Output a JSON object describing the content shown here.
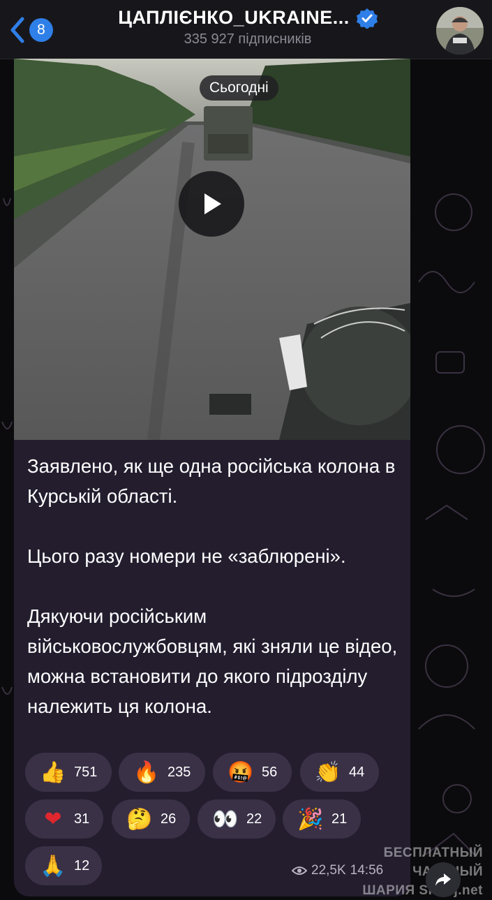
{
  "header": {
    "unread_count": "8",
    "channel_title": "ЦАПЛІЄНКО_UKRAINE...",
    "subscribers": "335 927 підписників"
  },
  "video": {
    "date_label": "Сьогодні"
  },
  "message": {
    "paragraphs": [
      "Заявлено, як ще одна російська колона в Курській області.",
      "Цього разу номери не «заблюрені».",
      "Дякуючи російським військовослужбовцям, які зняли це відео, можна встановити до якого підрозділу належить ця колона."
    ]
  },
  "reactions": [
    {
      "emoji": "👍",
      "count": "751"
    },
    {
      "emoji": "🔥",
      "count": "235"
    },
    {
      "emoji": "🤬",
      "count": "56"
    },
    {
      "emoji": "👏",
      "count": "44"
    },
    {
      "emoji": "❤",
      "count": "31"
    },
    {
      "emoji": "🤔",
      "count": "26"
    },
    {
      "emoji": "👀",
      "count": "22"
    },
    {
      "emoji": "🎉",
      "count": "21"
    },
    {
      "emoji": "🙏",
      "count": "12"
    }
  ],
  "meta": {
    "views": "22,5K",
    "time": "14:56"
  },
  "watermark": {
    "line1": "БЕСПЛАТНЫЙ ЧАСТНЫЙ",
    "line2": "ШАРИЯ Sharij.net"
  },
  "colors": {
    "accent": "#2f7fe8",
    "bubble": "#231d2e",
    "reaction_bg": "#3a3147"
  }
}
